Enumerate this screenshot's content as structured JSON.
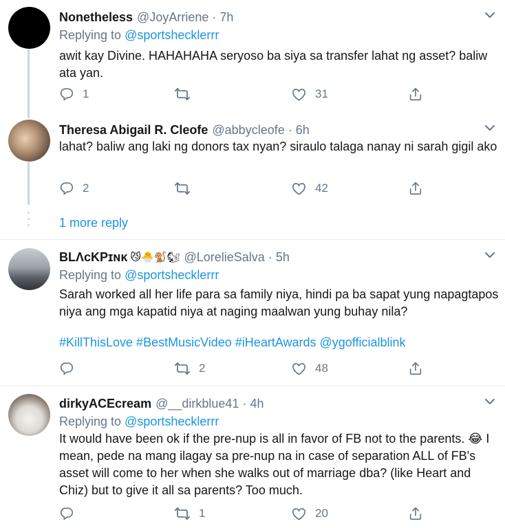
{
  "tweets": [
    {
      "name": "Nonetheless",
      "handle": "@JoyArriene",
      "dot": "·",
      "time": "7h",
      "replying_prefix": "Replying to",
      "replying_to": "@sportshecklerrr",
      "text": "awit kay Divine. HAHAHAHA seryoso ba siya sa transfer lahat ng asset? baliw ata yan.",
      "replies": "1",
      "retweets": "",
      "likes": "31"
    },
    {
      "name": "Theresa Abigail R. Cleofe",
      "handle": "@abbycleofe",
      "dot": "·",
      "time": "6h",
      "text": "lahat? baliw ang laki ng donors tax nyan? siraulo talaga nanay ni sarah gigil ako",
      "replies": "2",
      "retweets": "",
      "likes": "42"
    },
    {
      "name": "BLΛᴄKPɪɴᴋ",
      "emojis": "😼🐣🐒🐿",
      "handle": "@LorelieSalva",
      "dot": "·",
      "time": "5h",
      "replying_prefix": "Replying to",
      "replying_to": "@sportshecklerrr",
      "text": "Sarah worked all her life para sa family niya, hindi pa ba sapat yung napagtapos niya ang mga kapatid niya at naging maalwan yung buhay nila?",
      "hashtags": "#KillThisLove #BestMusicVideo #iHeartAwards @ygofficialblink",
      "replies": "",
      "retweets": "2",
      "likes": "48"
    },
    {
      "name": "dirkyACEcream",
      "handle": "@__dirkblue41",
      "dot": "·",
      "time": "4h",
      "replying_prefix": "Replying to",
      "replying_to": "@sportshecklerrr",
      "text": "It would have been ok if the pre-nup is all in favor of FB not to the parents. 😂 I mean, pede na mang ilagay sa pre-nup na in case of separation ALL of FB's asset will come to her when she walks out of marriage dba? (like Heart and Chiz) but to give it all sa parents? Too much.",
      "replies": "",
      "retweets": "1",
      "likes": "20"
    }
  ],
  "more_replies": "1 more reply",
  "colors": {
    "link": "#1b95e0",
    "secondary_text": "#657786",
    "primary_text": "#14171a",
    "separator": "#e6ecf0",
    "thread_line": "#ccd6dd"
  },
  "icons": [
    "reply-icon",
    "retweet-icon",
    "like-icon",
    "share-icon",
    "chevron-down-icon"
  ]
}
